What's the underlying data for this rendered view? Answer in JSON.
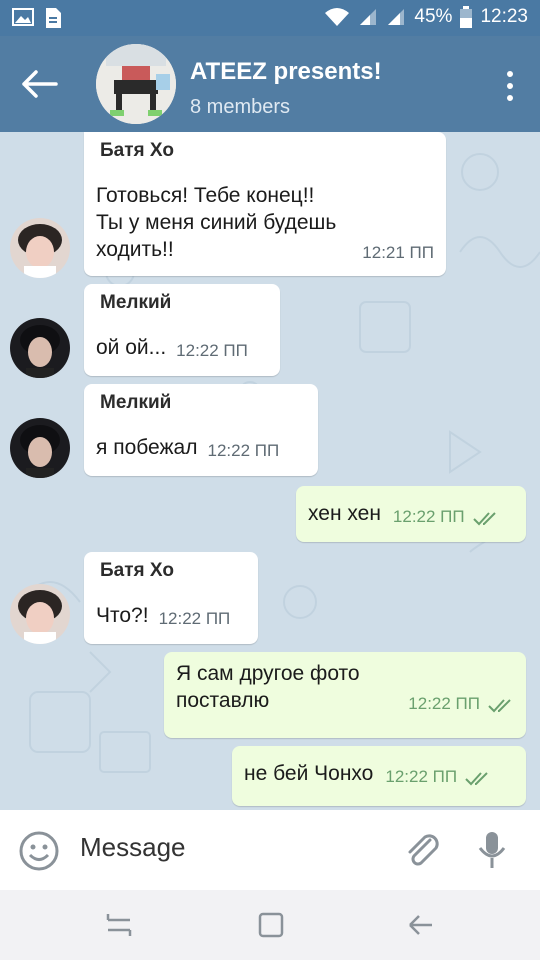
{
  "status_bar": {
    "battery": "45%",
    "time": "12:23"
  },
  "header": {
    "title": "ATEEZ presents!",
    "subtitle": "8 members"
  },
  "messages": [
    {
      "sender": "Батя Хо",
      "lines": [
        "Готовься! Тебе конец!!",
        "Ты у меня синий будешь",
        "ходить!!"
      ],
      "time": "12:21 ПП"
    },
    {
      "sender": "Мелкий",
      "text": "ой ой...",
      "time": "12:22 ПП"
    },
    {
      "sender": "Мелкий",
      "text": "я побежал",
      "time": "12:22 ПП"
    },
    {
      "text": "хен хен",
      "time": "12:22 ПП"
    },
    {
      "sender": "Батя Хо",
      "text": "Что?!",
      "time": "12:22 ПП"
    },
    {
      "lines": [
        "Я сам другое фото",
        "поставлю"
      ],
      "time": "12:22 ПП"
    },
    {
      "text": "не бей Чонхо",
      "time": "12:22 ПП"
    }
  ],
  "composer": {
    "placeholder": "Message"
  },
  "colors": {
    "header": "#527da3",
    "status": "#4a79a3",
    "outgoing": "#effdde",
    "check": "#6aa06e"
  },
  "icons": [
    "back-arrow-icon",
    "more-vert-icon",
    "emoji-icon",
    "attach-icon",
    "mic-icon",
    "wifi-icon",
    "signal-icon",
    "battery-icon"
  ]
}
